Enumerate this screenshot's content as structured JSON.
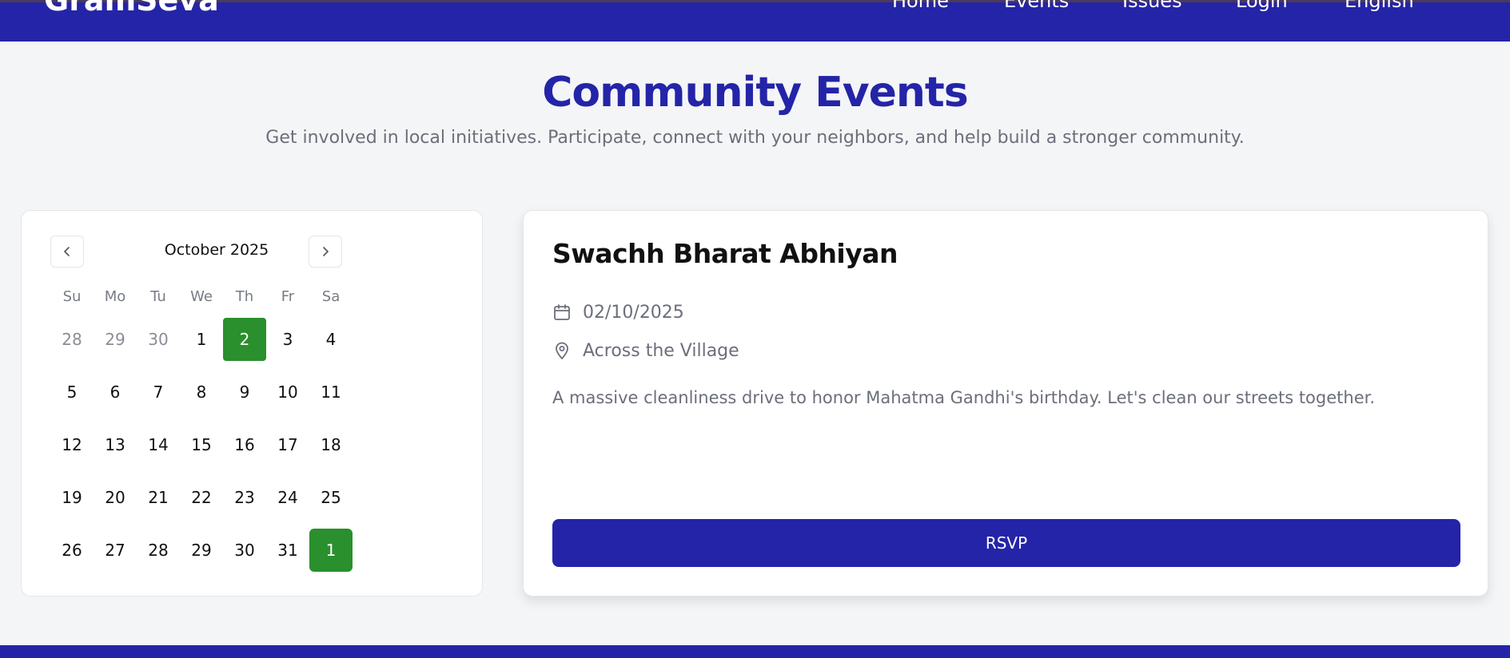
{
  "nav": {
    "brand": "GramSeva",
    "links": [
      "Home",
      "Events",
      "Issues",
      "Login",
      "English"
    ]
  },
  "header": {
    "title": "Community Events",
    "subtitle": "Get involved in local initiatives. Participate, connect with your neighbors, and help build a stronger community."
  },
  "calendar": {
    "month_label": "October 2025",
    "weekdays": [
      "Su",
      "Mo",
      "Tu",
      "We",
      "Th",
      "Fr",
      "Sa"
    ],
    "weeks": [
      [
        "28",
        "29",
        "30",
        "1",
        "2",
        "3",
        "4"
      ],
      [
        "5",
        "6",
        "7",
        "8",
        "9",
        "10",
        "11"
      ],
      [
        "12",
        "13",
        "14",
        "15",
        "16",
        "17",
        "18"
      ],
      [
        "19",
        "20",
        "21",
        "22",
        "23",
        "24",
        "25"
      ],
      [
        "26",
        "27",
        "28",
        "29",
        "30",
        "31",
        "1"
      ]
    ]
  },
  "event": {
    "title": "Swachh Bharat Abhiyan",
    "date": "02/10/2025",
    "location": "Across the Village",
    "description": "A massive cleanliness drive to honor Mahatma Gandhi's birthday. Let's clean our streets together.",
    "rsvp_label": "RSVP"
  },
  "colors": {
    "primary": "#2424a8",
    "highlight": "#2a8f2d"
  },
  "icons": {
    "prev": "chevron-left-icon",
    "next": "chevron-right-icon",
    "date": "calendar-icon",
    "location": "map-pin-icon"
  }
}
